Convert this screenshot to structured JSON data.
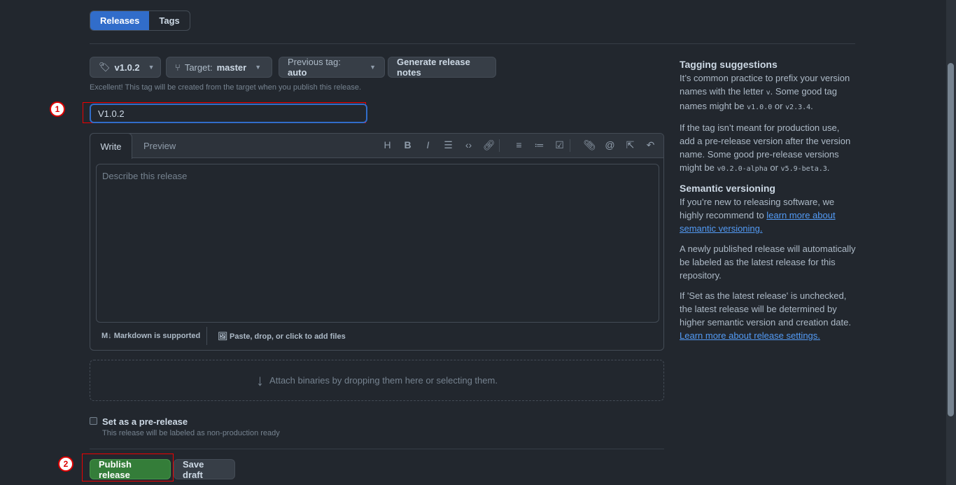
{
  "tabs": [
    {
      "label": "Releases",
      "active": true
    },
    {
      "label": "Tags",
      "active": false
    }
  ],
  "controls": {
    "tag": "v1.0.2",
    "target_label": "Target:",
    "target": "master",
    "previous_tag": "Previous tag: ",
    "previous_tag_value": "auto",
    "generate": "Generate release notes"
  },
  "tag_note": "Excellent! This tag will be created from the target when you publish this release.",
  "title_value": "V1.0.2",
  "editor": {
    "write": "Write",
    "preview": "Preview",
    "placeholder": "Describe this release",
    "markdown": "Markdown is supported",
    "files": "Paste, drop, or click to add files",
    "toolbar": [
      "heading-icon",
      "bold-icon",
      "italic-icon",
      "quote-icon",
      "code-icon",
      "link-icon",
      "ordered-list-icon",
      "unordered-list-icon",
      "task-list-icon",
      "attach-icon",
      "mention-icon",
      "reference-icon",
      "undo-icon"
    ]
  },
  "attach": "Attach binaries by dropping them here or selecting them.",
  "prerelease": {
    "label": "Set as a pre-release",
    "note": "This release will be labeled as non-production ready",
    "checked": false
  },
  "publish": "Publish release",
  "save_draft": "Save draft",
  "annotations": [
    "1",
    "2"
  ],
  "sidebar": {
    "h1": "Tagging suggestions",
    "p1a": "It’s common practice to prefix your version names with the letter ",
    "p1code": "v",
    "p1b": ". Some good tag names might be ",
    "p1c1": "v1.0.0",
    "p1or": " or ",
    "p1c2": "v2.3.4",
    "p1end": ".",
    "p2a": "If the tag isn’t meant for production use, add a pre-release version after the version name. Some good pre-release versions might be ",
    "p2c1": "v0.2.0-alpha",
    "p2or": " or ",
    "p2c2": "v5.9-beta.3",
    "p2end": ".",
    "h2": "Semantic versioning",
    "p3a": "If you’re new to releasing software, we highly recommend to ",
    "p3link": "learn more about semantic versioning.",
    "p4": "A newly published release will automatically be labeled as the latest release for this repository.",
    "p5a": "If 'Set as the latest release' is unchecked, the latest release will be determined by higher semantic version and creation date. ",
    "p5link": "Learn more about release settings."
  }
}
